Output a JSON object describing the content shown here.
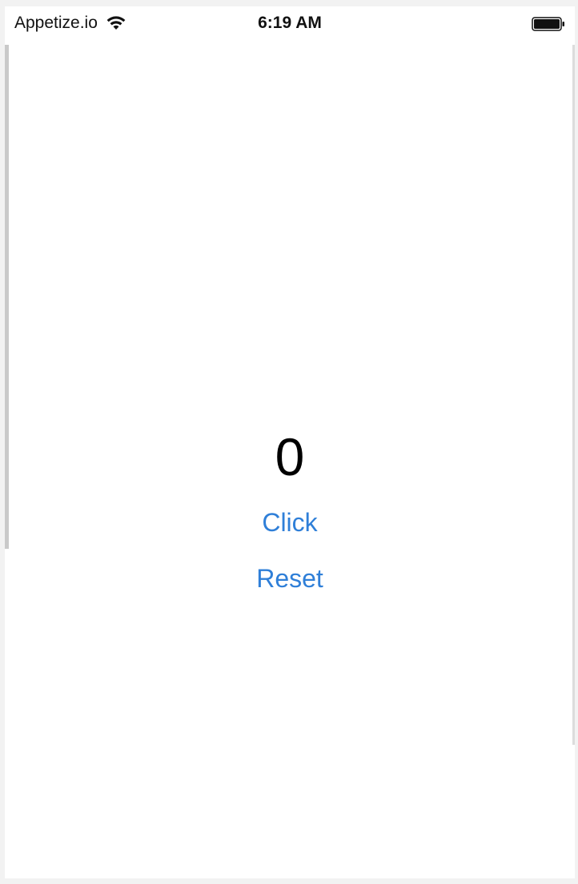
{
  "status_bar": {
    "carrier": "Appetize.io",
    "time": "6:19 AM",
    "wifi_icon": "wifi-icon",
    "battery_icon": "battery-icon"
  },
  "counter": {
    "value": "0"
  },
  "buttons": {
    "click_label": "Click",
    "reset_label": "Reset"
  },
  "colors": {
    "accent": "#2f7fd8",
    "background": "#ffffff"
  }
}
